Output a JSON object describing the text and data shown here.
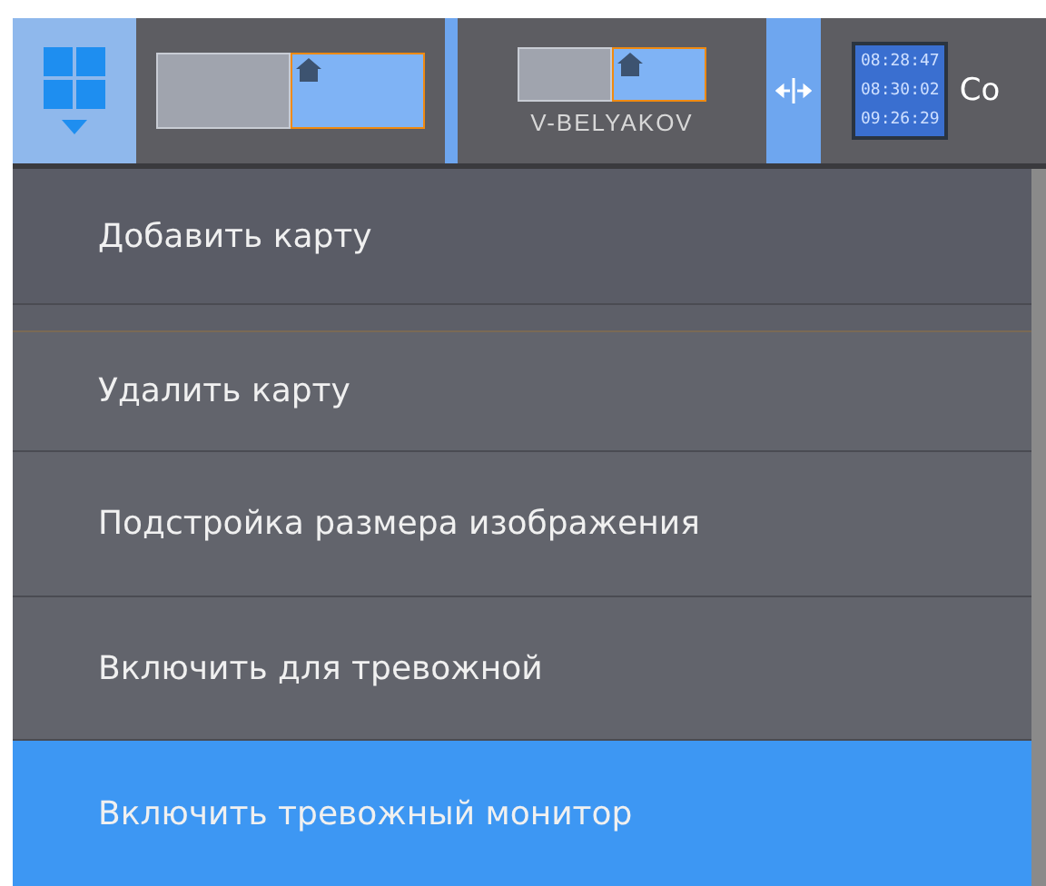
{
  "toolbar": {
    "layouts": [
      {
        "selected": false
      },
      {
        "label": "V-BELYAKOV",
        "selected": false
      }
    ],
    "clock": {
      "times": [
        "08:28:47",
        "08:30:02",
        "09:26:29"
      ]
    },
    "cut_label": "Co"
  },
  "menu": {
    "items": [
      {
        "label": "Добавить карту",
        "selected": false
      },
      {
        "label": "Удалить карту",
        "selected": false
      },
      {
        "label": "Подстройка размера изображения",
        "selected": false
      },
      {
        "label": "Включить для тревожной",
        "selected": false
      },
      {
        "label": "Включить тревожный монитор",
        "selected": true
      }
    ]
  }
}
